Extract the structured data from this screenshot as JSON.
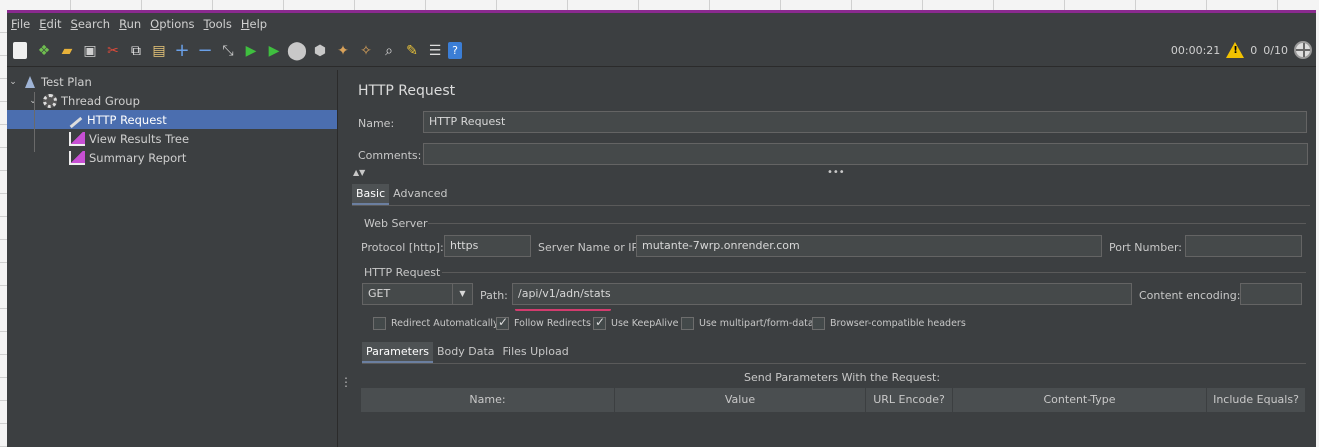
{
  "menu": [
    {
      "label": "File",
      "key": "F"
    },
    {
      "label": "Edit",
      "key": "E"
    },
    {
      "label": "Search",
      "key": "S"
    },
    {
      "label": "Run",
      "key": "R"
    },
    {
      "label": "Options",
      "key": "O"
    },
    {
      "label": "Tools",
      "key": "T"
    },
    {
      "label": "Help",
      "key": "H"
    }
  ],
  "toolbar": {
    "timer": "00:00:21",
    "warnings": "0",
    "threads": "0/10"
  },
  "tree": {
    "test_plan": "Test Plan",
    "thread_group": "Thread Group",
    "http_request": "HTTP Request",
    "view_results_tree": "View Results Tree",
    "summary_report": "Summary Report"
  },
  "panel": {
    "title": "HTTP Request",
    "name_label": "Name:",
    "name_value": "HTTP Request",
    "comments_label": "Comments:",
    "comments_value": "",
    "tabs": [
      "Basic",
      "Advanced"
    ],
    "web_server": "Web Server",
    "protocol_label": "Protocol [http]:",
    "protocol_value": "https",
    "server_label": "Server Name or IP:",
    "server_value": "mutante-7wrp.onrender.com",
    "port_label": "Port Number:",
    "port_value": "",
    "http_request_section": "HTTP Request",
    "method": "GET",
    "path_label": "Path:",
    "path_value": "/api/v1/adn/stats",
    "encoding_label": "Content encoding:",
    "encoding_value": "",
    "options": [
      {
        "label": "Redirect Automatically",
        "checked": false
      },
      {
        "label": "Follow Redirects",
        "checked": true
      },
      {
        "label": "Use KeepAlive",
        "checked": true
      },
      {
        "label": "Use multipart/form-data",
        "checked": false
      },
      {
        "label": "Browser-compatible headers",
        "checked": false
      }
    ],
    "subtabs": [
      "Parameters",
      "Body Data",
      "Files Upload"
    ],
    "send_params": "Send Parameters With the Request:",
    "columns": [
      "Name:",
      "Value",
      "URL Encode?",
      "Content-Type",
      "Include Equals?"
    ]
  }
}
